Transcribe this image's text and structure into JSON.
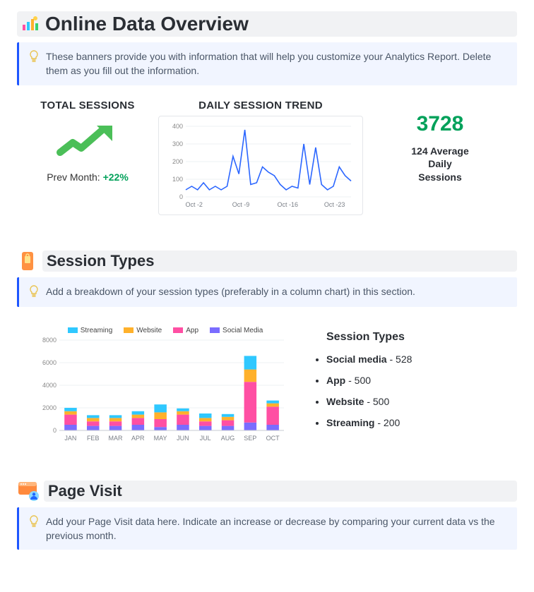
{
  "overview": {
    "title": "Online Data Overview",
    "banner": "These banners provide you with information that will help you customize your Analytics Report. Delete them as you fill out the information.",
    "total_sessions_label": "TOTAL SESSIONS",
    "prev_month_label": "Prev Month: ",
    "prev_month_delta": "+22%",
    "trend_label": "DAILY SESSION TREND",
    "big_number": "3728",
    "avg_line1": "124 Average",
    "avg_line2": "Daily",
    "avg_line3": "Sessions"
  },
  "session_types": {
    "title": "Session Types",
    "banner": "Add a breakdown of your session types (preferably in a column chart) in this section.",
    "list_title": "Session Types",
    "items": [
      {
        "label": "Social media",
        "value": "528"
      },
      {
        "label": "App",
        "value": "500"
      },
      {
        "label": "Website",
        "value": "500"
      },
      {
        "label": "Streaming",
        "value": "200"
      }
    ]
  },
  "page_visit": {
    "title": "Page Visit",
    "banner": "Add your Page Visit data here. Indicate an increase or decrease by comparing your current data vs the previous month."
  },
  "chart_data": [
    {
      "type": "line",
      "title": "DAILY SESSION TREND",
      "xlabel": "",
      "ylabel": "",
      "x_ticks": [
        "Oct -2",
        "Oct -9",
        "Oct -16",
        "Oct -23"
      ],
      "y_ticks": [
        0,
        100,
        200,
        300,
        400
      ],
      "ylim": [
        0,
        400
      ],
      "series": [
        {
          "name": "sessions",
          "values": [
            40,
            60,
            40,
            80,
            40,
            60,
            40,
            60,
            230,
            130,
            380,
            70,
            80,
            170,
            140,
            120,
            70,
            40,
            60,
            50,
            300,
            70,
            280,
            70,
            40,
            60,
            170,
            120,
            90
          ]
        }
      ]
    },
    {
      "type": "bar",
      "stacked": true,
      "categories": [
        "JAN",
        "FEB",
        "MAR",
        "APR",
        "MAY",
        "JUN",
        "JUL",
        "AUG",
        "SEP",
        "OCT"
      ],
      "ylim": [
        0,
        8000
      ],
      "y_ticks": [
        0,
        2000,
        4000,
        6000,
        8000
      ],
      "series": [
        {
          "name": "Streaming",
          "color": "#2fc8ff",
          "values": [
            300,
            250,
            250,
            300,
            700,
            250,
            400,
            250,
            1200,
            250
          ]
        },
        {
          "name": "Website",
          "color": "#ffb12b",
          "values": [
            300,
            300,
            300,
            300,
            600,
            300,
            300,
            300,
            1100,
            300
          ]
        },
        {
          "name": "App",
          "color": "#ff4fa3",
          "values": [
            900,
            400,
            400,
            600,
            700,
            900,
            400,
            500,
            3600,
            1600
          ]
        },
        {
          "name": "Social Media",
          "color": "#7a6cff",
          "values": [
            500,
            400,
            400,
            500,
            300,
            500,
            400,
            400,
            700,
            500
          ]
        }
      ]
    }
  ]
}
